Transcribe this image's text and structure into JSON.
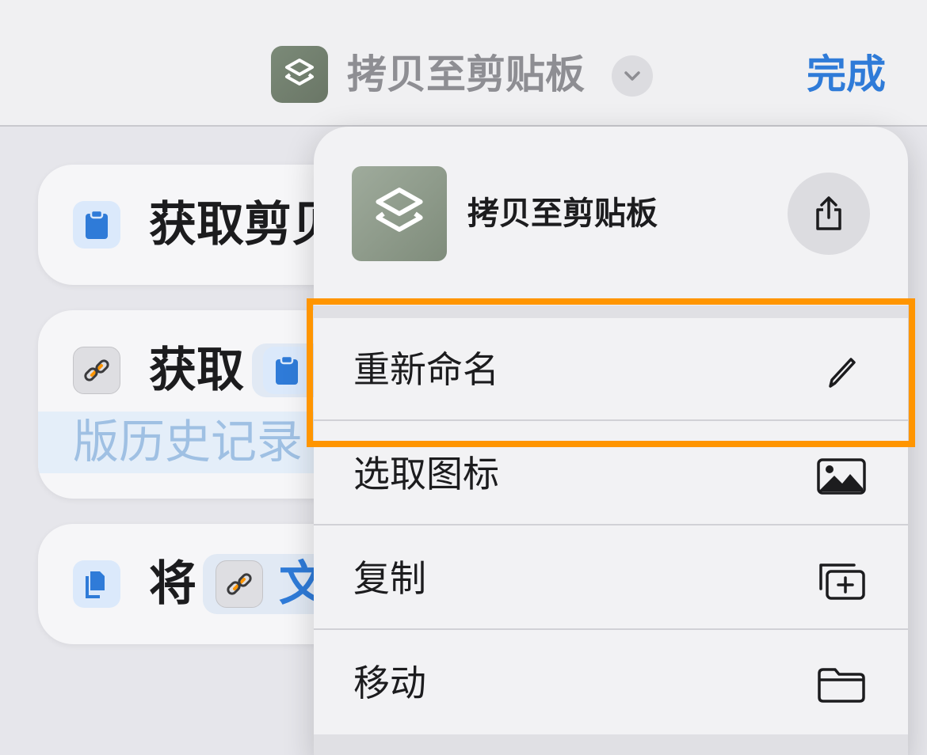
{
  "topbar": {
    "title": "拷贝至剪贴板",
    "done_label": "完成"
  },
  "cards": [
    {
      "icon": "clipboard-icon",
      "text": "获取剪贝"
    },
    {
      "icon": "link-icon",
      "text": "获取",
      "subtext": "版历史记录"
    },
    {
      "icon": "copy-icon",
      "text": "将",
      "chip_text": "文"
    }
  ],
  "menu": {
    "header_title": "拷贝至剪贴板",
    "items": [
      {
        "label": "重新命名",
        "icon": "pencil-icon"
      },
      {
        "label": "选取图标",
        "icon": "photo-icon"
      },
      {
        "label": "复制",
        "icon": "duplicate-icon"
      },
      {
        "label": "移动",
        "icon": "folder-icon"
      }
    ]
  },
  "colors": {
    "accent": "#2f7bd8",
    "highlight": "#ff9500",
    "app_icon": "#7f8c7b"
  }
}
